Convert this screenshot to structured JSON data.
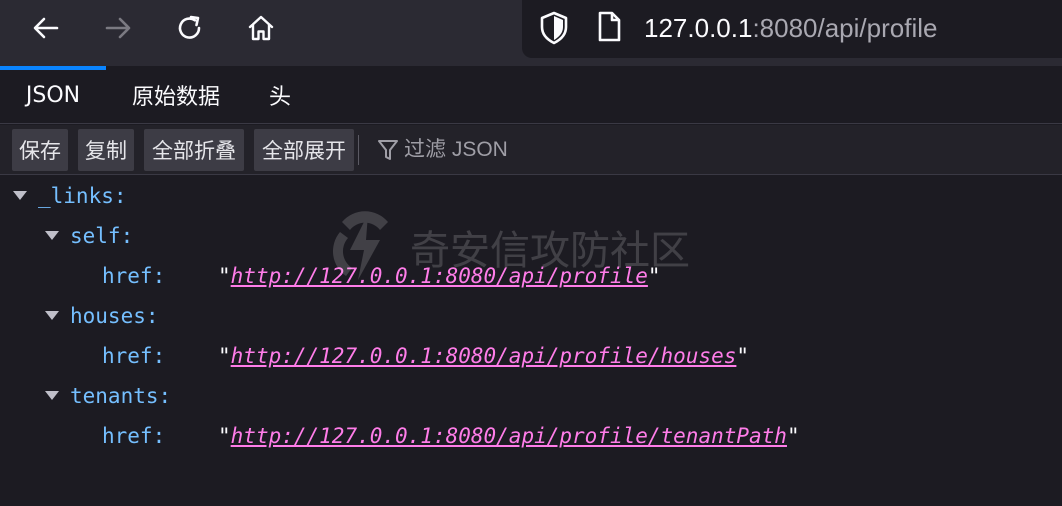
{
  "browser": {
    "url_host": "127.0.0.1",
    "url_path": ":8080/api/profile",
    "icons": [
      "back-arrow-icon",
      "forward-arrow-icon",
      "reload-icon",
      "home-icon",
      "shield-icon",
      "page-icon"
    ]
  },
  "viewer": {
    "tabs": [
      {
        "label": "JSON",
        "active": true
      },
      {
        "label": "原始数据",
        "active": false
      },
      {
        "label": "头",
        "active": false
      }
    ],
    "actions": {
      "save": "保存",
      "copy": "复制",
      "collapse_all": "全部折叠",
      "expand_all": "全部展开"
    },
    "filter_placeholder": "过滤 JSON"
  },
  "json": {
    "root_key": "_links:",
    "self_key": "self:",
    "self_href_key": "href:",
    "self_href": "http://127.0.0.1:8080/api/profile",
    "houses_key": "houses:",
    "houses_href_key": "href:",
    "houses_href": "http://127.0.0.1:8080/api/profile/houses",
    "tenants_key": "tenants:",
    "tenants_href_key": "href:",
    "tenants_href": "http://127.0.0.1:8080/api/profile/tenantPath"
  },
  "watermark": {
    "text": "奇安信攻防社区"
  },
  "colors": {
    "accent": "#0a84ff",
    "key": "#75bfff",
    "link": "#ff7de9",
    "background": "#1c1b22"
  }
}
